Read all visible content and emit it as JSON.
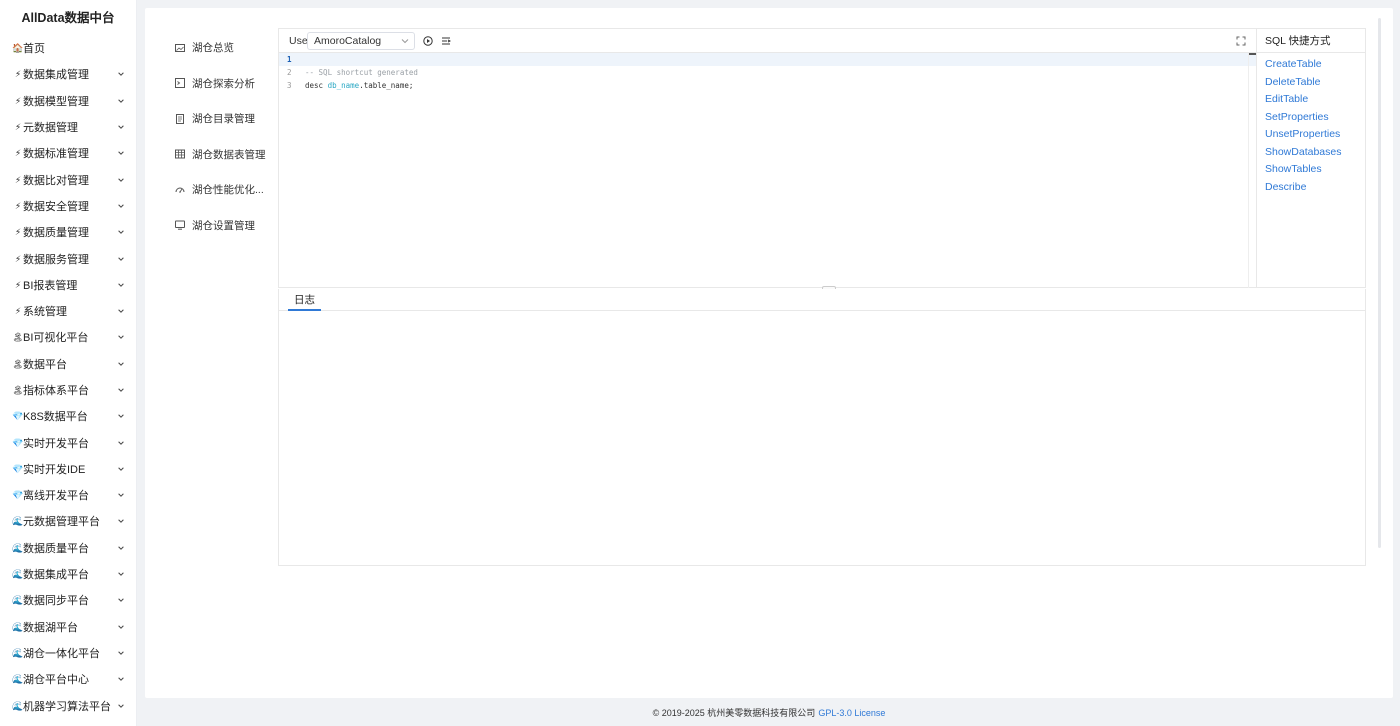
{
  "app": {
    "title": "AllData数据中台"
  },
  "sidebar": {
    "items": [
      {
        "label": "首页",
        "icon": "home-icon",
        "icon_glyph": "🏠",
        "has_children": false
      },
      {
        "label": "数据集成管理",
        "icon": "lightning-icon",
        "icon_glyph": "⚡",
        "has_children": true
      },
      {
        "label": "数据模型管理",
        "icon": "lightning-icon",
        "icon_glyph": "⚡",
        "has_children": true
      },
      {
        "label": "元数据管理",
        "icon": "lightning-icon",
        "icon_glyph": "⚡",
        "has_children": true
      },
      {
        "label": "数据标准管理",
        "icon": "lightning-icon",
        "icon_glyph": "⚡",
        "has_children": true
      },
      {
        "label": "数据比对管理",
        "icon": "lightning-icon",
        "icon_glyph": "⚡",
        "has_children": true
      },
      {
        "label": "数据安全管理",
        "icon": "lightning-icon",
        "icon_glyph": "⚡",
        "has_children": true
      },
      {
        "label": "数据质量管理",
        "icon": "lightning-icon",
        "icon_glyph": "⚡",
        "has_children": true
      },
      {
        "label": "数据服务管理",
        "icon": "lightning-icon",
        "icon_glyph": "⚡",
        "has_children": true
      },
      {
        "label": "BI报表管理",
        "icon": "lightning-icon",
        "icon_glyph": "⚡",
        "has_children": true
      },
      {
        "label": "系统管理",
        "icon": "lightning-icon",
        "icon_glyph": "⚡",
        "has_children": true
      },
      {
        "label": "BI可视化平台",
        "icon": "palm-tree-icon",
        "icon_glyph": "🏝",
        "has_children": true
      },
      {
        "label": "数据平台",
        "icon": "palm-tree-icon",
        "icon_glyph": "🏝",
        "has_children": true
      },
      {
        "label": "指标体系平台",
        "icon": "palm-tree-icon",
        "icon_glyph": "🏝",
        "has_children": true
      },
      {
        "label": "K8S数据平台",
        "icon": "diamond-icon",
        "icon_glyph": "💎",
        "has_children": true
      },
      {
        "label": "实时开发平台",
        "icon": "diamond-icon",
        "icon_glyph": "💎",
        "has_children": true
      },
      {
        "label": "实时开发IDE",
        "icon": "diamond-icon",
        "icon_glyph": "💎",
        "has_children": true
      },
      {
        "label": "离线开发平台",
        "icon": "diamond-icon",
        "icon_glyph": "💎",
        "has_children": true
      },
      {
        "label": "元数据管理平台",
        "icon": "wave-icon",
        "icon_glyph": "🌊",
        "has_children": true
      },
      {
        "label": "数据质量平台",
        "icon": "wave-icon",
        "icon_glyph": "🌊",
        "has_children": true
      },
      {
        "label": "数据集成平台",
        "icon": "wave-icon",
        "icon_glyph": "🌊",
        "has_children": true
      },
      {
        "label": "数据同步平台",
        "icon": "wave-icon",
        "icon_glyph": "🌊",
        "has_children": true
      },
      {
        "label": "数据湖平台",
        "icon": "wave-icon",
        "icon_glyph": "🌊",
        "has_children": true
      },
      {
        "label": "湖仓一体化平台",
        "icon": "wave-icon",
        "icon_glyph": "🌊",
        "has_children": true
      },
      {
        "label": "湖仓平台中心",
        "icon": "wave-icon",
        "icon_glyph": "🌊",
        "has_children": true
      },
      {
        "label": "机器学习算法平台",
        "icon": "wave-icon",
        "icon_glyph": "🌊",
        "has_children": true
      }
    ]
  },
  "lake_menu": {
    "items": [
      {
        "label": "湖仓总览",
        "icon": "image-icon"
      },
      {
        "label": "湖仓探索分析",
        "icon": "terminal-icon"
      },
      {
        "label": "湖仓目录管理",
        "icon": "document-icon"
      },
      {
        "label": "湖仓数据表管理",
        "icon": "table-icon"
      },
      {
        "label": "湖仓性能优化...",
        "icon": "gauge-icon"
      },
      {
        "label": "湖仓设置管理",
        "icon": "monitor-icon"
      }
    ]
  },
  "editor": {
    "use_label": "Use",
    "catalog": "AmoroCatalog",
    "lines": [
      {
        "num": "1",
        "parts": []
      },
      {
        "num": "2",
        "parts": [
          {
            "t": "-- SQL shortcut generated",
            "c": "comment"
          }
        ]
      },
      {
        "num": "3",
        "parts": [
          {
            "t": "desc ",
            "c": "text"
          },
          {
            "t": "db_name",
            "c": "ident"
          },
          {
            "t": ".table_name;",
            "c": "text"
          }
        ]
      }
    ]
  },
  "shortcuts": {
    "title": "SQL 快捷方式",
    "items": [
      "CreateTable",
      "DeleteTable",
      "EditTable",
      "SetProperties",
      "UnsetProperties",
      "ShowDatabases",
      "ShowTables",
      "Describe"
    ]
  },
  "log": {
    "tab_label": "日志"
  },
  "footer": {
    "copyright": "© 2019-2025 杭州美零数据科技有限公司",
    "license": "GPL-3.0 License"
  },
  "colors": {
    "accent": "#2f79d6",
    "ident": "#2aa8c4",
    "comment": "#9aa0a6"
  }
}
